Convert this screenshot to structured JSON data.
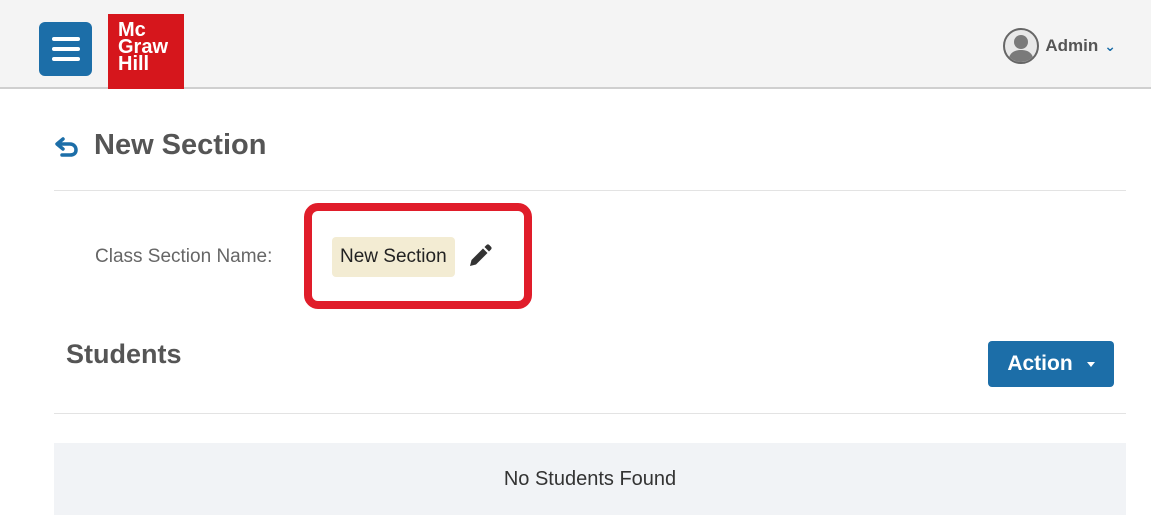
{
  "header": {
    "menu_icon": "hamburger-menu-icon",
    "logo_lines": [
      "Mc",
      "Graw",
      "Hill"
    ],
    "user": {
      "name": "Admin",
      "avatar_icon": "user-avatar-icon",
      "dropdown_icon": "chevron-down-icon"
    }
  },
  "page": {
    "back_icon": "back-arrow-icon",
    "title": "New Section"
  },
  "section": {
    "label": "Class Section Name:",
    "name": "New Section",
    "edit_icon": "pencil-icon"
  },
  "students": {
    "title": "Students",
    "action_label": "Action",
    "empty_message": "No Students Found"
  },
  "colors": {
    "brand_blue": "#1c6ea8",
    "brand_red": "#d6161c",
    "highlight_red": "#e01d2a",
    "chip_bg": "#f3ecd3"
  }
}
